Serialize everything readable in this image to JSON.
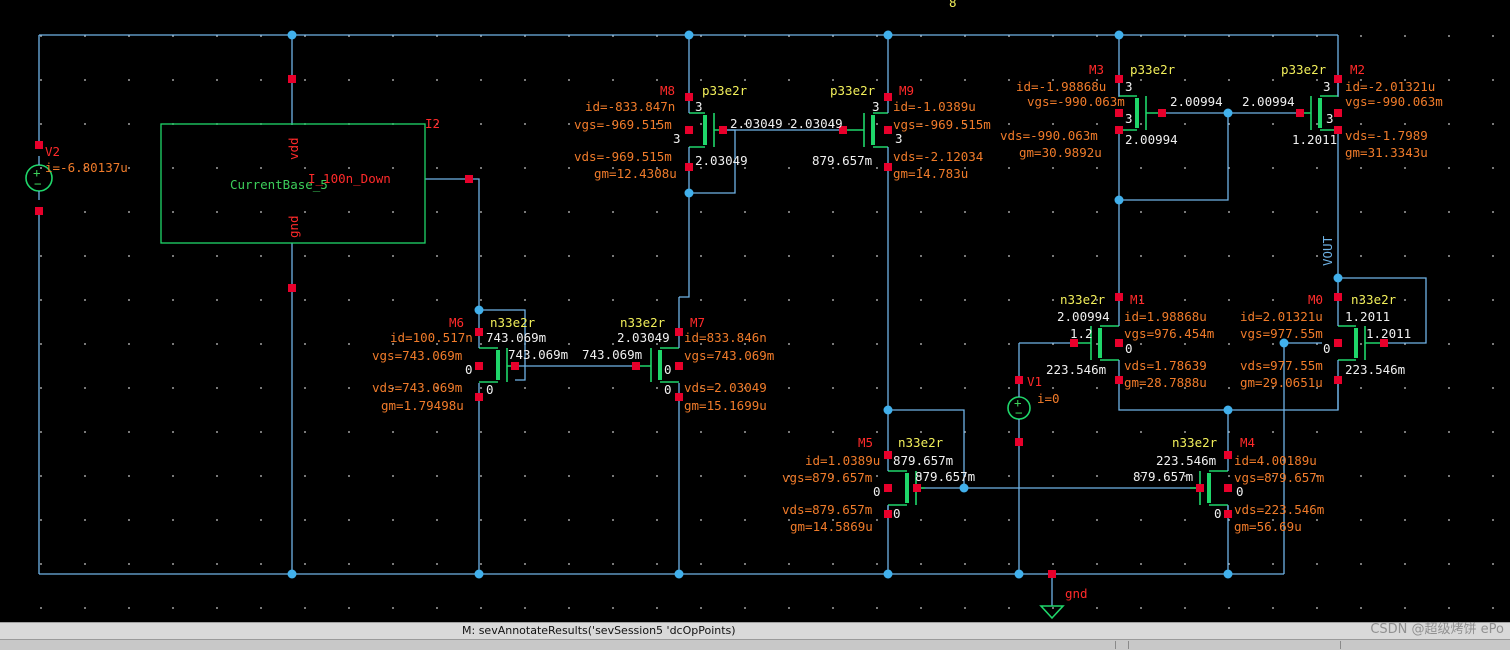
{
  "colors": {
    "background": "#000000",
    "wire": "#6fb3e6",
    "pin": "#e8002b",
    "transistor": "#1fd66a",
    "annotation": "#f07b2a",
    "instance_name": "#ff2a2a",
    "model": "#f2ef5a"
  },
  "icons": {
    "ground": "ground-symbol-icon",
    "vsource": "voltage-source-icon",
    "probe": "probe-marker-icon"
  },
  "top_marker": "8",
  "v2": {
    "name": "V2",
    "current": "i=-6.80137u"
  },
  "v1": {
    "name": "V1",
    "current": "i=0"
  },
  "i2": {
    "name": "I2",
    "cell": "CurrentBase_5",
    "pin_vdd": "vdd",
    "pin_gnd": "gnd",
    "pin_out": "I_100n_Down"
  },
  "gnd_label": "gnd",
  "vout_label": "VOUT",
  "m8": {
    "name": "M8",
    "model": "p33e2r",
    "id": "id=-833.847n",
    "vgs": "vgs=-969.515m",
    "vds": "vds=-969.515m",
    "gm": "gm=12.4308u",
    "t1": "3",
    "t2": "3",
    "g": "2.03049",
    "d": "2.03049"
  },
  "m9": {
    "name": "M9",
    "model": "p33e2r",
    "id": "id=-1.0389u",
    "vgs": "vgs=-969.515m",
    "vds": "vds=-2.12034",
    "gm": "gm=14.783u",
    "t1": "3",
    "t2": "3",
    "g": "2.03049",
    "d": "879.657m"
  },
  "m3": {
    "name": "M3",
    "model": "p33e2r",
    "id": "id=-1.98868u",
    "vgs": "vgs=-990.063m",
    "vds": "vds=-990.063m",
    "gm": "gm=30.9892u",
    "t1": "3",
    "t2": "3",
    "g": "2.00994",
    "d": "2.00994"
  },
  "m2": {
    "name": "M2",
    "model": "p33e2r",
    "id": "id=-2.01321u",
    "vgs": "vgs=-990.063m",
    "vds": "vds=-1.7989",
    "gm": "gm=31.3343u",
    "t1": "3",
    "t2": "3",
    "g": "2.00994",
    "d": "1.2011"
  },
  "m6": {
    "name": "M6",
    "model": "n33e2r",
    "id": "id=100.517n",
    "vgs": "vgs=743.069m",
    "vds": "vds=743.069m",
    "gm": "gm=1.79498u",
    "t1": "0",
    "t2": "0",
    "g": "743.069m",
    "d": "743.069m"
  },
  "m7": {
    "name": "M7",
    "model": "n33e2r",
    "id": "id=833.846n",
    "vgs": "vgs=743.069m",
    "vds": "vds=2.03049",
    "gm": "gm=15.1699u",
    "t1": "0",
    "t2": "0",
    "g": "743.069m",
    "d": "2.03049"
  },
  "m1": {
    "name": "M1",
    "model": "n33e2r",
    "id": "id=1.98868u",
    "vgs": "vgs=976.454m",
    "vds": "vds=1.78639",
    "gm": "gm=28.7888u",
    "t1": "0",
    "g": "1.2",
    "d": "2.00994",
    "s": "223.546m"
  },
  "m0": {
    "name": "M0",
    "model": "n33e2r",
    "id": "id=2.01321u",
    "vgs": "vgs=977.55m",
    "vds": "vds=977.55m",
    "gm": "gm=29.0651u",
    "t1": "0",
    "g": "1.2011",
    "d": "1.2011",
    "s": "223.546m"
  },
  "m5": {
    "name": "M5",
    "model": "n33e2r",
    "id": "id=1.0389u",
    "vgs": "vgs=879.657m",
    "vds": "vds=879.657m",
    "gm": "gm=14.5869u",
    "t1": "0",
    "t2": "0",
    "g": "879.657m",
    "d": "879.657m"
  },
  "m4": {
    "name": "M4",
    "model": "n33e2r",
    "id": "id=4.00189u",
    "vgs": "vgs=879.657m",
    "vds": "vds=223.546m",
    "gm": "gm=56.69u",
    "t1": "0",
    "t2": "0",
    "g": "879.657m",
    "d": "223.546m"
  },
  "status": {
    "command": "M: sevAnnotateResults('sevSession5 'dcOpPoints)"
  },
  "watermark": "CSDN @超级烤饼 ePo"
}
